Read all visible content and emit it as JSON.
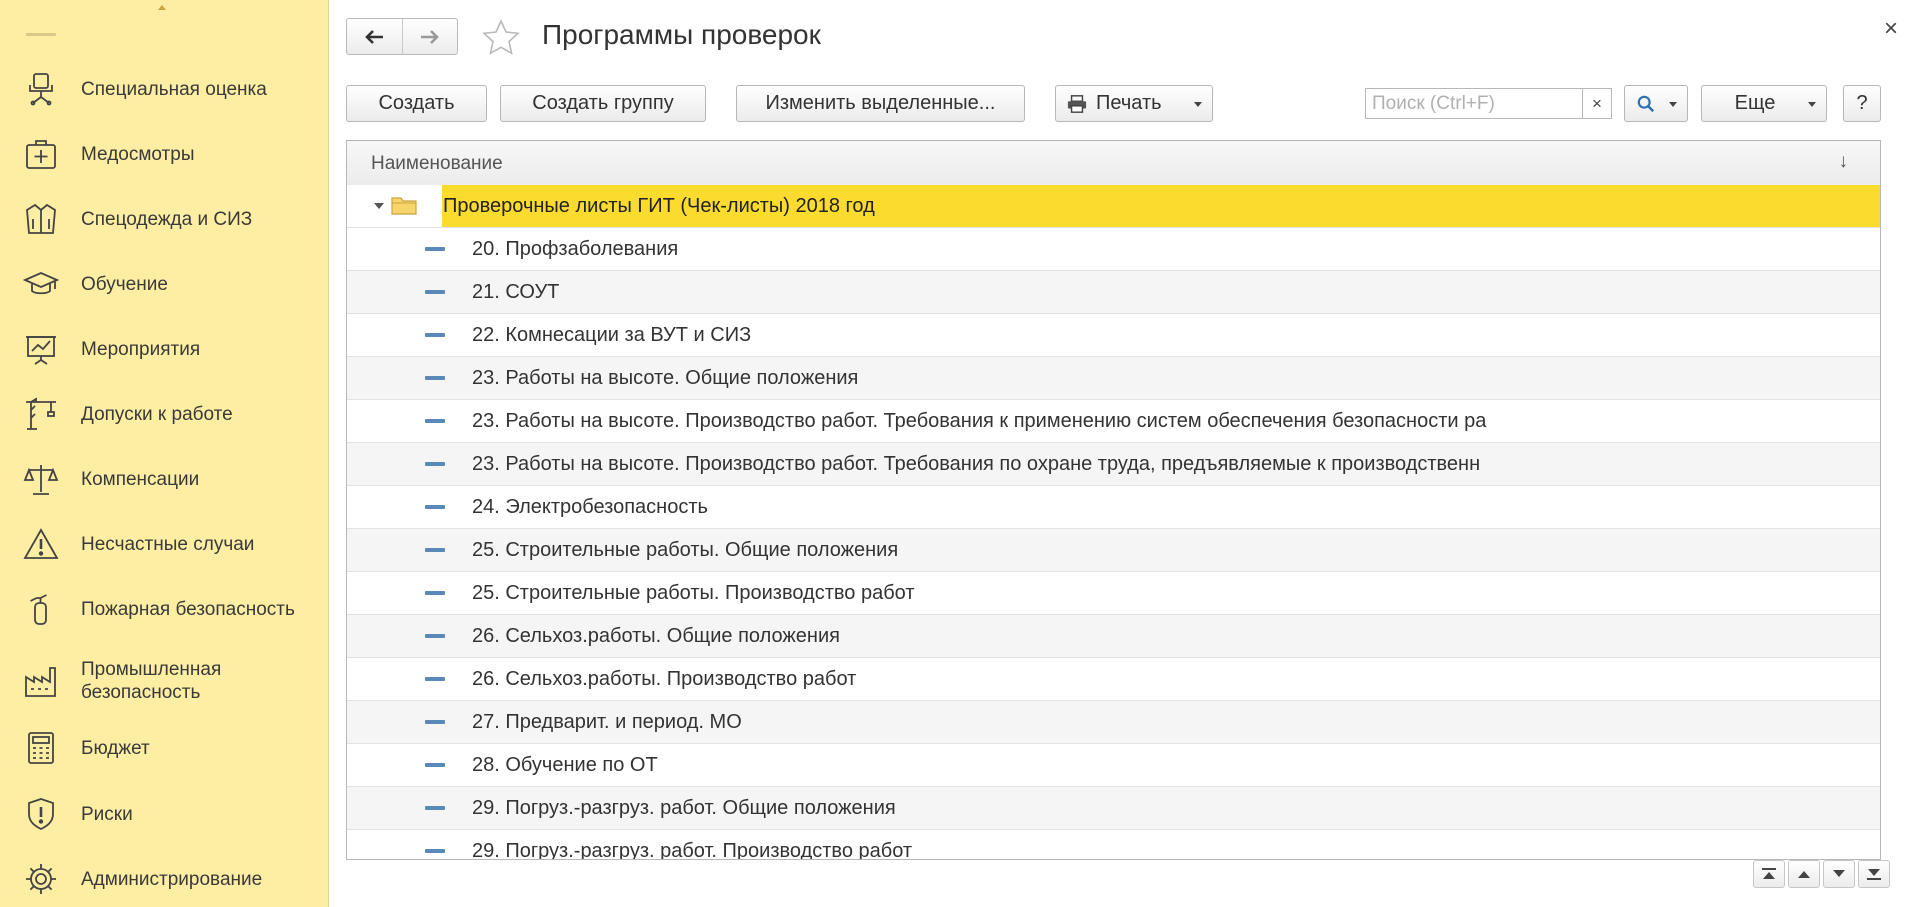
{
  "sidebar": {
    "items": [
      {
        "label": "Специальная оценка",
        "icon": "office-chair-icon"
      },
      {
        "label": "Медосмотры",
        "icon": "first-aid-kit-icon"
      },
      {
        "label": "Спецодежда и СИЗ",
        "icon": "jacket-icon"
      },
      {
        "label": "Обучение",
        "icon": "graduation-cap-icon"
      },
      {
        "label": "Мероприятия",
        "icon": "presentation-board-icon"
      },
      {
        "label": "Допуски к работе",
        "icon": "crane-icon"
      },
      {
        "label": "Компенсации",
        "icon": "scales-icon"
      },
      {
        "label": "Несчастные случаи",
        "icon": "warning-triangle-icon"
      },
      {
        "label": "Пожарная безопасность",
        "icon": "fire-extinguisher-icon"
      },
      {
        "label": "Промышленная\nбезопасность",
        "icon": "factory-icon"
      },
      {
        "label": "Бюджет",
        "icon": "calculator-icon"
      },
      {
        "label": "Риски",
        "icon": "shield-exclamation-icon"
      },
      {
        "label": "Администрирование",
        "icon": "gear-icon"
      }
    ]
  },
  "header": {
    "title": "Программы проверок",
    "close_label": "×"
  },
  "toolbar": {
    "create_label": "Создать",
    "create_group_label": "Создать группу",
    "edit_selected_label": "Изменить выделенные...",
    "print_label": "Печать",
    "search_placeholder": "Поиск (Ctrl+F)",
    "search_clear": "×",
    "more_label": "Еще",
    "help_label": "?"
  },
  "table": {
    "column_name": "Наименование",
    "sort_indicator": "↓",
    "group_row": "Проверочные листы ГИТ (Чек-листы) 2018 год",
    "rows": [
      "20. Профзаболевания",
      "21. СОУТ",
      "22. Комнесации за ВУТ и СИЗ",
      "23. Работы на высоте. Общие положения",
      "23. Работы на высоте. Производство работ. Требования к применению систем обеспечения безопасности ра",
      "23. Работы на высоте. Производство работ. Требования по охране труда, предъявляемые к производственн",
      "24. Электробезопасность",
      "25. Строительные работы. Общие положения",
      "25. Строительные работы. Производство работ",
      "26. Сельхоз.работы. Общие положения",
      "26. Сельхоз.работы. Производство работ",
      "27. Предварит. и период. МО",
      "28. Обучение по ОТ",
      "29. Погруз.-разгруз. работ. Общие положения",
      "29. Погруз.-разгруз. работ. Производство работ"
    ]
  },
  "colors": {
    "sidebar_bg": "#fdeea3",
    "selection": "#fcdb2f",
    "item_marker": "#5a88b8"
  }
}
